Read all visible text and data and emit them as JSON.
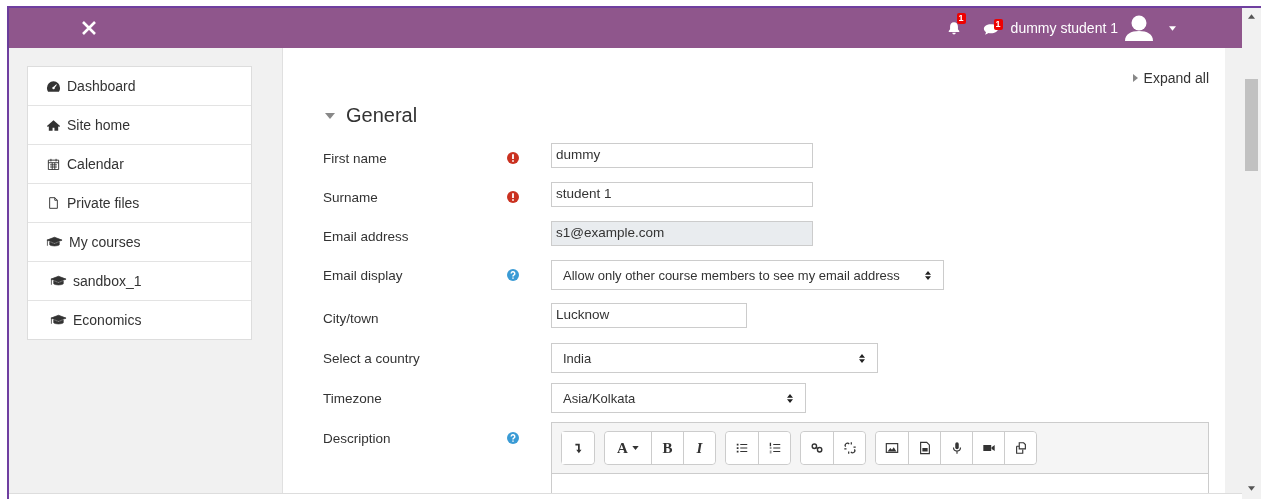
{
  "navbar": {
    "notification_count": "1",
    "message_count": "1",
    "user_name": "dummy student 1"
  },
  "sidebar": {
    "items": [
      {
        "label": "Dashboard",
        "kind": "dashboard"
      },
      {
        "label": "Site home",
        "kind": "home"
      },
      {
        "label": "Calendar",
        "kind": "calendar"
      },
      {
        "label": "Private files",
        "kind": "file"
      },
      {
        "label": "My courses",
        "kind": "courses",
        "children": [
          {
            "label": "sandbox_1",
            "kind": "courses"
          },
          {
            "label": "Economics",
            "kind": "courses"
          }
        ]
      }
    ]
  },
  "expand_all": "Expand all",
  "section": {
    "title": "General",
    "expanded": true
  },
  "fields": [
    {
      "label": "First name",
      "required": true,
      "help": false,
      "kind": "text",
      "value": "dummy"
    },
    {
      "label": "Surname",
      "required": true,
      "help": false,
      "kind": "text",
      "value": "student 1"
    },
    {
      "label": "Email address",
      "required": false,
      "help": false,
      "kind": "readonly",
      "value": "s1@example.com"
    },
    {
      "label": "Email display",
      "required": false,
      "help": true,
      "kind": "select",
      "value": "Allow only other course members to see my email address"
    },
    {
      "label": "City/town",
      "required": false,
      "help": false,
      "kind": "text",
      "value": "Lucknow"
    },
    {
      "label": "Select a country",
      "required": false,
      "help": false,
      "kind": "select",
      "value": "India"
    },
    {
      "label": "Timezone",
      "required": false,
      "help": false,
      "kind": "select",
      "value": "Asia/Kolkata"
    },
    {
      "label": "Description",
      "required": false,
      "help": true,
      "kind": "editor",
      "toolbar": [
        [
          {
            "kind": "collapse"
          }
        ],
        [
          {
            "kind": "font",
            "label": "A"
          },
          {
            "kind": "bold",
            "label": "B"
          },
          {
            "kind": "italic",
            "label": "I"
          }
        ],
        [
          {
            "kind": "bullets"
          },
          {
            "kind": "numbers"
          }
        ],
        [
          {
            "kind": "link"
          },
          {
            "kind": "unlink"
          }
        ],
        [
          {
            "kind": "image"
          },
          {
            "kind": "media"
          },
          {
            "kind": "audio"
          },
          {
            "kind": "video"
          },
          {
            "kind": "files"
          }
        ]
      ]
    }
  ]
}
